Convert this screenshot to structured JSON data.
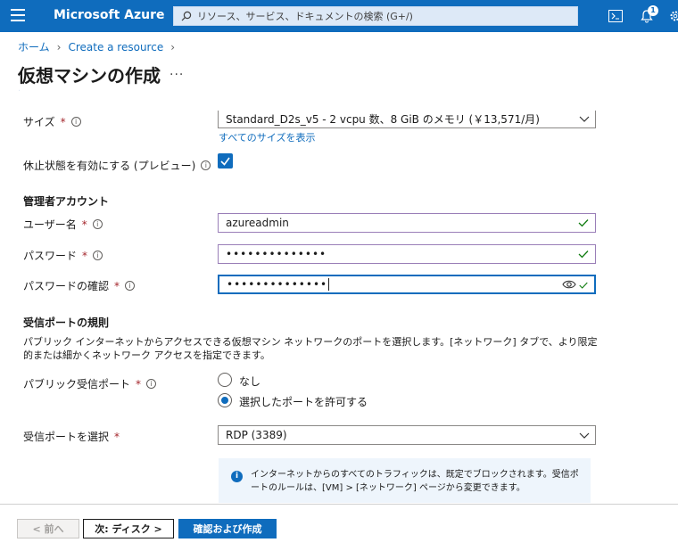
{
  "topbar": {
    "brand": "Microsoft Azure",
    "search_placeholder": "リソース、サービス、ドキュメントの検索 (G+/)",
    "notification_count": "1"
  },
  "breadcrumb": {
    "home": "ホーム",
    "create": "Create a resource"
  },
  "page": {
    "title": "仮想マシンの作成",
    "more": "..."
  },
  "size": {
    "label": "サイズ",
    "value": "Standard_D2s_v5 - 2 vcpu 数、8 GiB のメモリ (￥13,571/月)",
    "see_all": "すべてのサイズを表示"
  },
  "hibernate": {
    "label": "休止状態を有効にする (プレビュー)",
    "checked": true
  },
  "admin": {
    "heading": "管理者アカウント",
    "username_label": "ユーザー名",
    "username_value": "azureadmin",
    "password_label": "パスワード",
    "password_value": "••••••••••••••",
    "confirm_label": "パスワードの確認",
    "confirm_value": "••••••••••••••"
  },
  "inbound": {
    "heading": "受信ポートの規則",
    "description": "パブリック インターネットからアクセスできる仮想マシン ネットワークのポートを選択します。[ネットワーク] タブで、より限定的または細かくネットワーク アクセスを指定できます。",
    "public_ports_label": "パブリック受信ポート",
    "option_none": "なし",
    "option_allow": "選択したポートを許可する",
    "select_label": "受信ポートを選択",
    "select_value": "RDP (3389)",
    "info": "インターネットからのすべてのトラフィックは、既定でブロックされます。受信ポートのルールは、[VM] > [ネットワーク] ページから変更できます。"
  },
  "footer": {
    "prev": "< 前へ",
    "next": "次: ディスク >",
    "create": "確認および作成"
  },
  "colors": {
    "accent": "#0f6cbd",
    "valid_border": "#9a7fb8",
    "check": "#107c10"
  }
}
